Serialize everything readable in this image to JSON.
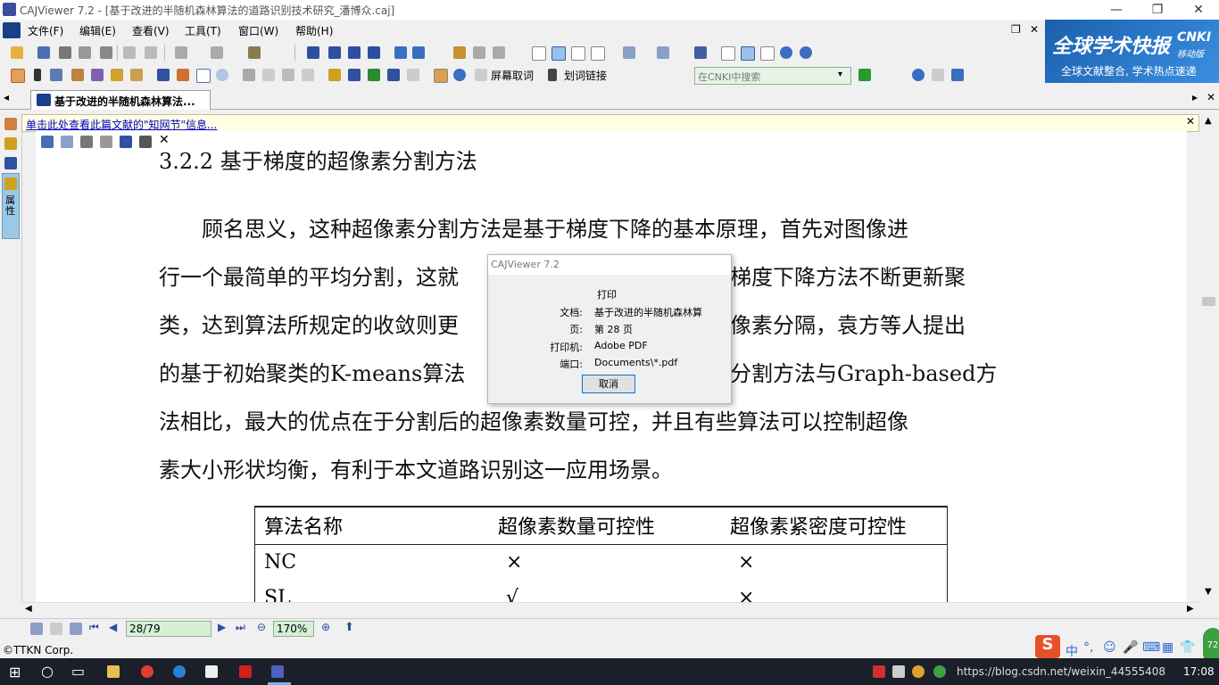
{
  "window": {
    "title": "CAJViewer 7.2 - [基于改进的半随机森林算法的道路识别技术研究_潘博众.caj]",
    "minimize": "—",
    "restore": "❐",
    "close": "✕"
  },
  "menu": {
    "items": [
      "文件(F)",
      "编辑(E)",
      "查看(V)",
      "工具(T)",
      "窗口(W)",
      "帮助(H)"
    ],
    "mdi_restore": "❐",
    "mdi_close": "✕"
  },
  "toolbar": {
    "screen_word": "屏幕取词",
    "word_link": "划词链接",
    "cnki_search_placeholder": "在CNKI中搜索"
  },
  "banner": {
    "title": "全球学术快报",
    "brand": "CNKI",
    "mobile": "移动版",
    "subtitle": "全球文献整合, 学术热点速递"
  },
  "tab": {
    "label": "基于改进的半随机森林算法..."
  },
  "infobar": {
    "text": "单击此处查看此篇文献的\"知网节\"信息..."
  },
  "leftpanel": {
    "property_label": "属性"
  },
  "document": {
    "heading": "3.2.2  基于梯度的超像素分割方法",
    "lines": [
      "　　顾名思义，这种超像素分割方法是基于梯度下降的基本原理，首先对图像进",
      "行一个最简单的平均分割，这就",
      "类，达到算法所规定的收敛则更",
      "的基于初始聚类的K-means算法",
      "法相比，最大的优点在于分割后的超像素数量可控，并且有些算法可以控制超像",
      "素大小形状均衡，有利于本文道路识别这一应用场景。"
    ],
    "line_tails": [
      "梯度下降方法不断更新聚",
      "像素分隔，袁方等人提出",
      "分割方法与Graph-based方"
    ],
    "table": {
      "headers": [
        "算法名称",
        "超像素数量可控性",
        "超像素紧密度可控性"
      ],
      "rows": [
        [
          "NC",
          "×",
          "×"
        ],
        [
          "SL",
          "√",
          "×"
        ]
      ]
    }
  },
  "dialog": {
    "title": "CAJViewer 7.2",
    "heading": "打印",
    "doc_label": "文档:",
    "doc_value": "基于改进的半随机森林算",
    "page_label": "页:",
    "page_value": "第 28 页",
    "printer_label": "打印机:",
    "printer_value": "Adobe PDF",
    "port_label": "端口:",
    "port_value": "Documents\\*.pdf",
    "cancel": "取消"
  },
  "statusbar": {
    "page": "28/79",
    "zoom": "170%"
  },
  "copyright": "©TTKN Corp.",
  "taskbar": {
    "watermark": "https://blog.csdn.net/weixin_44555408",
    "clock": "17:08",
    "ime": "中",
    "badge": "72"
  },
  "colors": {
    "banner_bg": "#1a5fae",
    "link": "#0000cc",
    "infobar_bg": "#ffffe1",
    "taskbar_bg": "#1b1f2a"
  }
}
